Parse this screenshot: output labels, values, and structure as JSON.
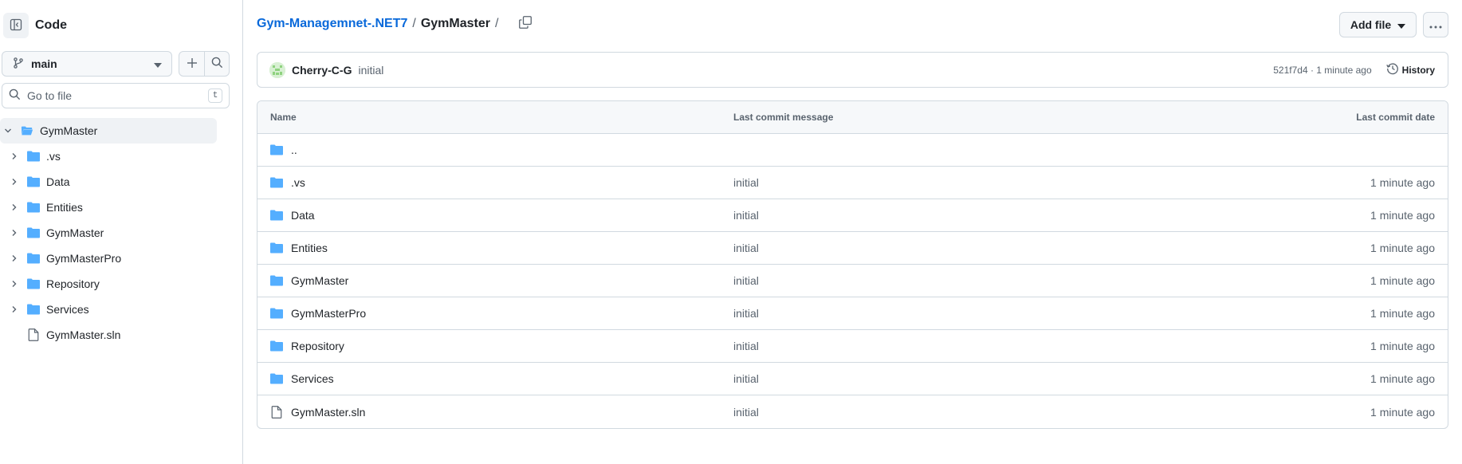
{
  "sidebar": {
    "title": "Code",
    "branch": "main",
    "goto_placeholder": "Go to file",
    "goto_shortcut": "t",
    "tree": [
      {
        "name": "GymMaster",
        "type": "folder",
        "expanded": true,
        "level": 0
      },
      {
        "name": ".vs",
        "type": "folder",
        "level": 1
      },
      {
        "name": "Data",
        "type": "folder",
        "level": 1
      },
      {
        "name": "Entities",
        "type": "folder",
        "level": 1
      },
      {
        "name": "GymMaster",
        "type": "folder",
        "level": 1
      },
      {
        "name": "GymMasterPro",
        "type": "folder",
        "level": 1
      },
      {
        "name": "Repository",
        "type": "folder",
        "level": 1
      },
      {
        "name": "Services",
        "type": "folder",
        "level": 1
      },
      {
        "name": "GymMaster.sln",
        "type": "file",
        "level": 1
      }
    ]
  },
  "breadcrumb": {
    "repo": "Gym-Managemnet-.NET7",
    "sep1": "/",
    "current": "GymMaster",
    "sep2": "/"
  },
  "actions": {
    "add_file": "Add file"
  },
  "commit": {
    "author": "Cherry-C-G",
    "message": "initial",
    "meta": "521f7d4 · 1 minute ago",
    "history": "History"
  },
  "table": {
    "headers": {
      "name": "Name",
      "message": "Last commit message",
      "date": "Last commit date"
    },
    "rows": [
      {
        "name": "..",
        "type": "folder",
        "message": "",
        "date": ""
      },
      {
        "name": ".vs",
        "type": "folder",
        "message": "initial",
        "date": "1 minute ago"
      },
      {
        "name": "Data",
        "type": "folder",
        "message": "initial",
        "date": "1 minute ago"
      },
      {
        "name": "Entities",
        "type": "folder",
        "message": "initial",
        "date": "1 minute ago"
      },
      {
        "name": "GymMaster",
        "type": "folder",
        "message": "initial",
        "date": "1 minute ago"
      },
      {
        "name": "GymMasterPro",
        "type": "folder",
        "message": "initial",
        "date": "1 minute ago"
      },
      {
        "name": "Repository",
        "type": "folder",
        "message": "initial",
        "date": "1 minute ago"
      },
      {
        "name": "Services",
        "type": "folder",
        "message": "initial",
        "date": "1 minute ago"
      },
      {
        "name": "GymMaster.sln",
        "type": "file",
        "message": "initial",
        "date": "1 minute ago"
      }
    ]
  },
  "colors": {
    "folder": "#54aeff",
    "link": "#0969da",
    "muted": "#59636e",
    "border": "#d1d9e0"
  }
}
